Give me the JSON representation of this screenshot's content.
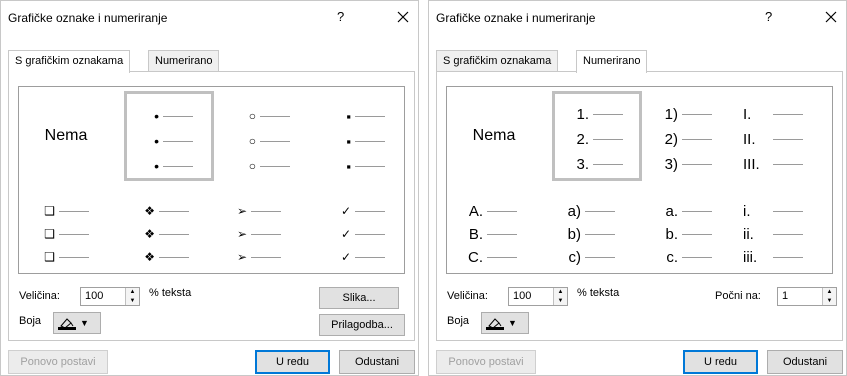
{
  "dialogs": [
    {
      "title": "Grafičke oznake i numeriranje",
      "help": "?",
      "tabs": [
        "S grafičkim oznakama",
        "Numerirano"
      ],
      "active_tab": 0,
      "none_label": "Nema",
      "gallery": [
        [
          "•",
          "•",
          "•"
        ],
        [
          "○",
          "○",
          "○"
        ],
        [
          "▪",
          "▪",
          "▪"
        ],
        [
          "❑",
          "❑",
          "❑"
        ],
        [
          "❖",
          "❖",
          "❖"
        ],
        [
          "➢",
          "➢",
          "➢"
        ],
        [
          "✓",
          "✓",
          "✓"
        ]
      ],
      "size_label": "Veličina:",
      "size_value": "100",
      "size_unit": "% teksta",
      "color_label": "Boja",
      "side_buttons": [
        "Slika...",
        "Prilagodba..."
      ],
      "reset": "Ponovo postavi",
      "ok": "U redu",
      "cancel": "Odustani"
    },
    {
      "title": "Grafičke oznake i numeriranje",
      "help": "?",
      "tabs": [
        "S grafičkim oznakama",
        "Numerirano"
      ],
      "active_tab": 1,
      "none_label": "Nema",
      "gallery": [
        [
          "1.",
          "2.",
          "3."
        ],
        [
          "1)",
          "2)",
          "3)"
        ],
        [
          "I.",
          "II.",
          "III."
        ],
        [
          "A.",
          "B.",
          "C."
        ],
        [
          "a)",
          "b)",
          "c)"
        ],
        [
          "a.",
          "b.",
          "c."
        ],
        [
          "i.",
          "ii.",
          "iii."
        ]
      ],
      "size_label": "Veličina:",
      "size_value": "100",
      "size_unit": "% teksta",
      "start_label": "Počni na:",
      "start_value": "1",
      "color_label": "Boja",
      "reset": "Ponovo postavi",
      "ok": "U redu",
      "cancel": "Odustani"
    }
  ],
  "icons": {
    "close": "close-icon",
    "font-color": "font-color-icon",
    "dropdown": "chevron-down-icon",
    "spin-up": "spin-up-icon",
    "spin-down": "spin-down-icon"
  },
  "colors": {
    "selected_border": "#c0c0c0",
    "default_button_border": "#0078d7"
  }
}
